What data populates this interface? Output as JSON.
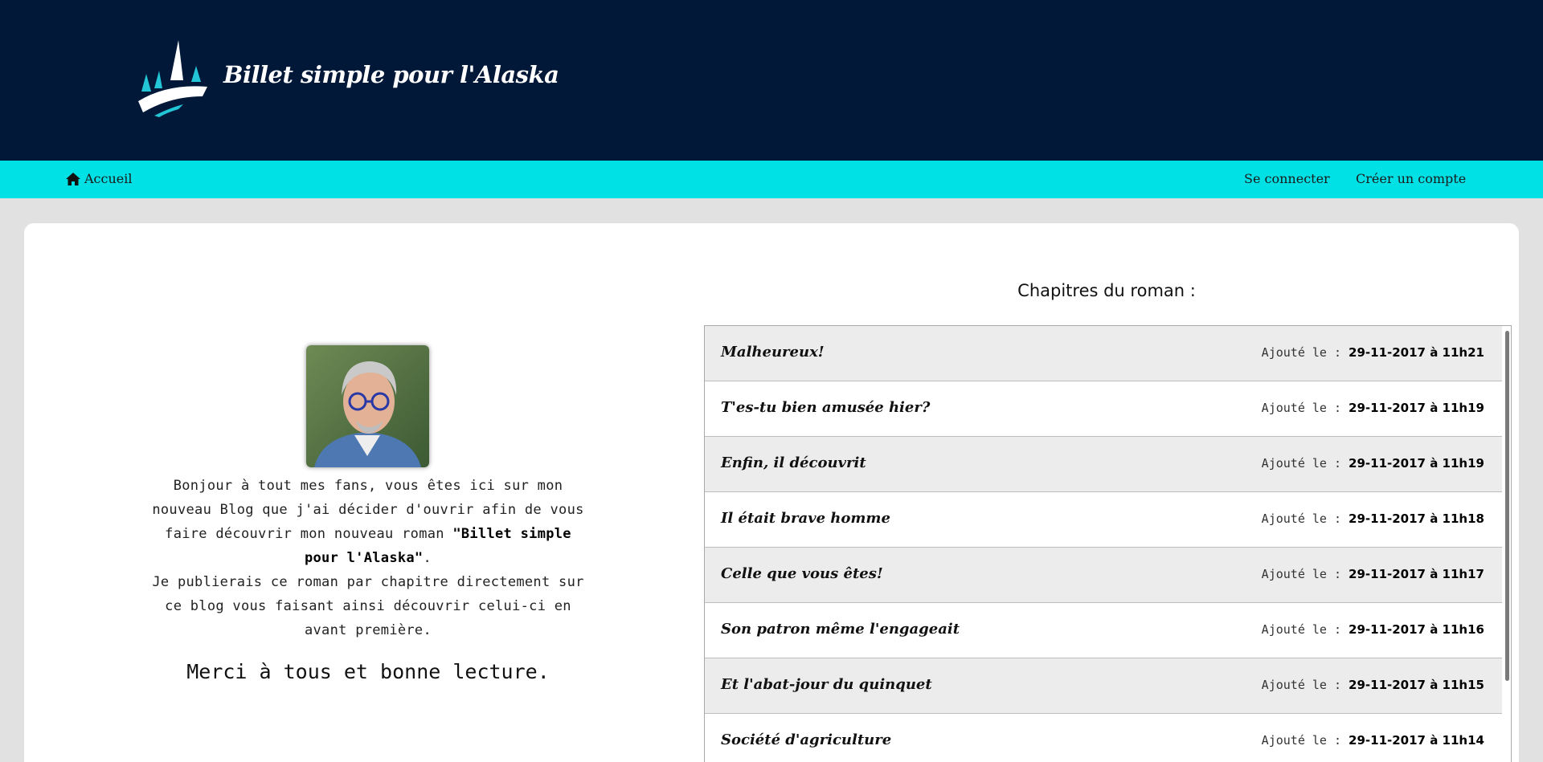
{
  "header": {
    "site_title": "Billet simple pour l'Alaska",
    "colors": {
      "background": "#011839",
      "accent": "#00e1e6"
    },
    "logo_icon": "ship-sail-logo"
  },
  "nav": {
    "home_icon": "home-icon",
    "home_label": "Accueil",
    "login_label": "Se connecter",
    "register_label": "Créer un compte"
  },
  "intro": {
    "avatar_icon": "author-avatar",
    "text_part1": "Bonjour à tout mes fans, vous êtes ici sur mon nouveau Blog que j'ai décider d'ouvrir afin de vous faire découvrir mon nouveau roman ",
    "novel_title": "\"Billet simple pour l'Alaska\"",
    "text_part2": ".",
    "text_part3": "Je publierais ce roman par chapitre directement sur ce blog vous faisant ainsi découvrir celui-ci en avant première.",
    "thanks": "Merci à tous et bonne lecture."
  },
  "chapters": {
    "title": "Chapitres du roman :",
    "added_prefix": "Ajouté le : ",
    "items": [
      {
        "title": "Malheureux!",
        "date": "29-11-2017 à 11h21"
      },
      {
        "title": "T'es-tu bien amusée hier?",
        "date": "29-11-2017 à 11h19"
      },
      {
        "title": "Enfin, il découvrit",
        "date": "29-11-2017 à 11h19"
      },
      {
        "title": "Il était brave homme",
        "date": "29-11-2017 à 11h18"
      },
      {
        "title": "Celle que vous êtes!",
        "date": "29-11-2017 à 11h17"
      },
      {
        "title": "Son patron même l'engageait",
        "date": "29-11-2017 à 11h16"
      },
      {
        "title": "Et l'abat-jour du quinquet",
        "date": "29-11-2017 à 11h15"
      },
      {
        "title": "Société d'agriculture",
        "date": "29-11-2017 à 11h14"
      }
    ]
  }
}
